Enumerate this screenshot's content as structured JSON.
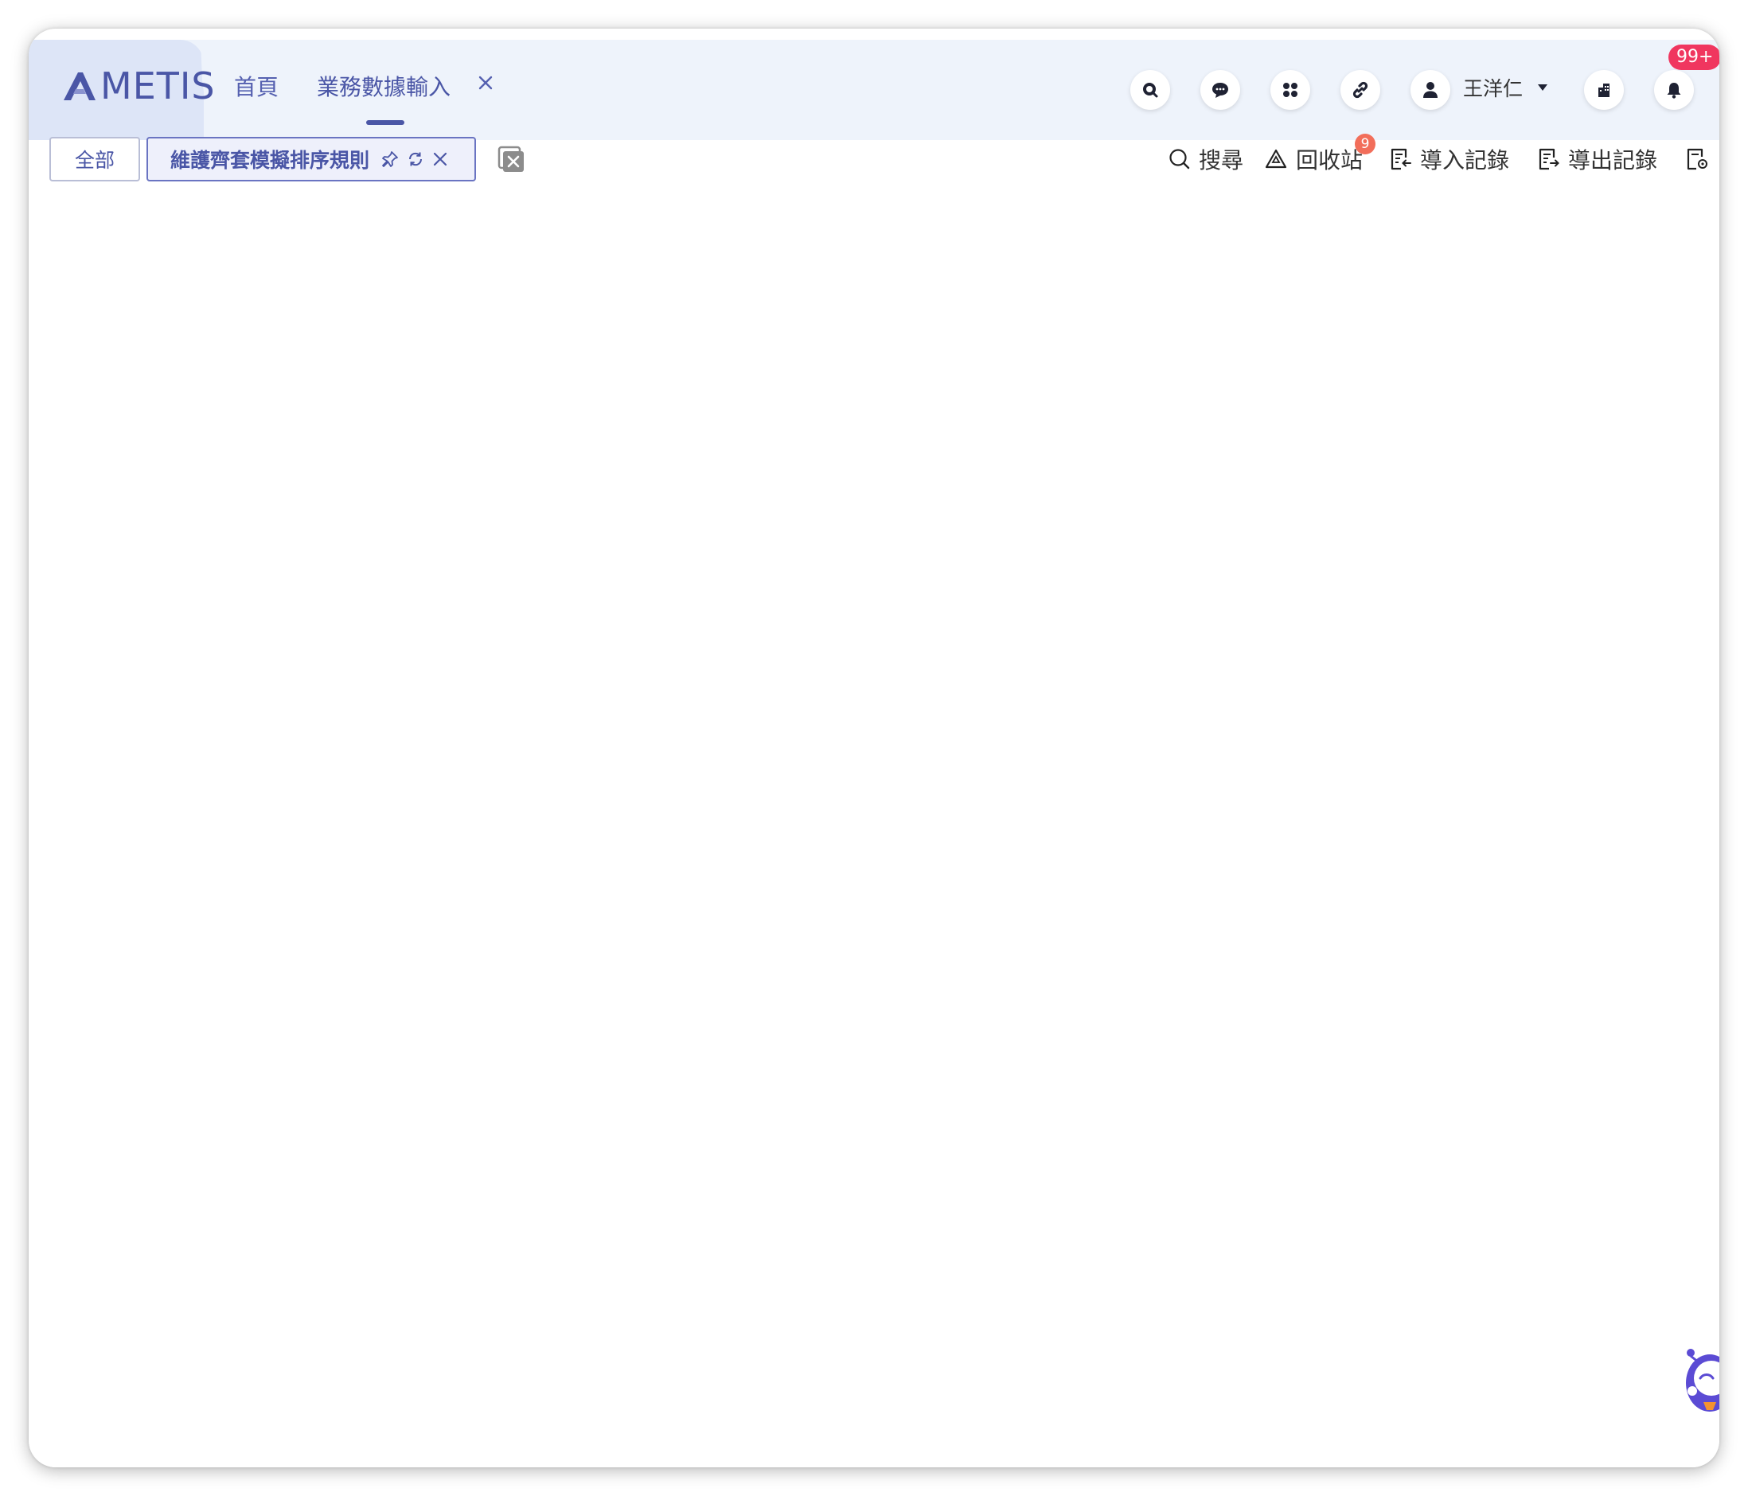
{
  "header": {
    "logo_text": "METIS",
    "nav": {
      "home_label": "首頁",
      "active_label": "業務數據輸入"
    },
    "user": {
      "name": "王洋仁"
    },
    "notifications": {
      "badge": "99+"
    },
    "icons": {
      "search": "search-icon",
      "chat": "chat-icon",
      "apps": "apps-grid-icon",
      "link": "link-icon",
      "user": "user-icon",
      "building": "building-icon",
      "bell": "bell-icon"
    }
  },
  "tabbar": {
    "all_label": "全部",
    "current_label": "維護齊套模擬排序規則"
  },
  "toolbar": {
    "search_label": "搜尋",
    "recycle_label": "回收站",
    "recycle_badge": "9",
    "import_label": "導入記錄",
    "export_label": "導出記錄"
  },
  "colors": {
    "brand": "#4a56a6",
    "header_bg": "#eef3fb",
    "badge_red": "#f0365f",
    "recycle_badge": "#f26e5a"
  }
}
